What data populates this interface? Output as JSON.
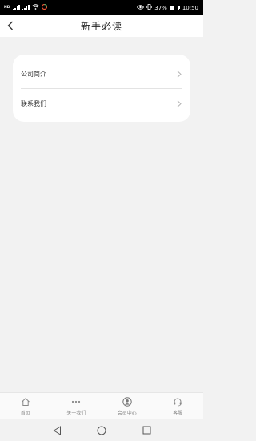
{
  "status_bar": {
    "network_label": "HD",
    "battery_percent": "37%",
    "battery_level": 0.37,
    "time": "10:50"
  },
  "header": {
    "title": "新手必读",
    "back_icon": "chevron-left-icon"
  },
  "menu": {
    "items": [
      {
        "label": "公司简介",
        "icon": "chevron-right-icon"
      },
      {
        "label": "联系我们",
        "icon": "chevron-right-icon"
      }
    ]
  },
  "tabbar": {
    "tabs": [
      {
        "label": "首页",
        "icon": "home-icon"
      },
      {
        "label": "关于我们",
        "icon": "more-dots-icon"
      },
      {
        "label": "会员中心",
        "icon": "user-circle-icon"
      },
      {
        "label": "客服",
        "icon": "headset-icon"
      }
    ]
  },
  "colors": {
    "page_bg": "#f2f2f2",
    "card_bg": "#ffffff",
    "status_bar_bg": "#000000",
    "tab_label": "#888888"
  }
}
